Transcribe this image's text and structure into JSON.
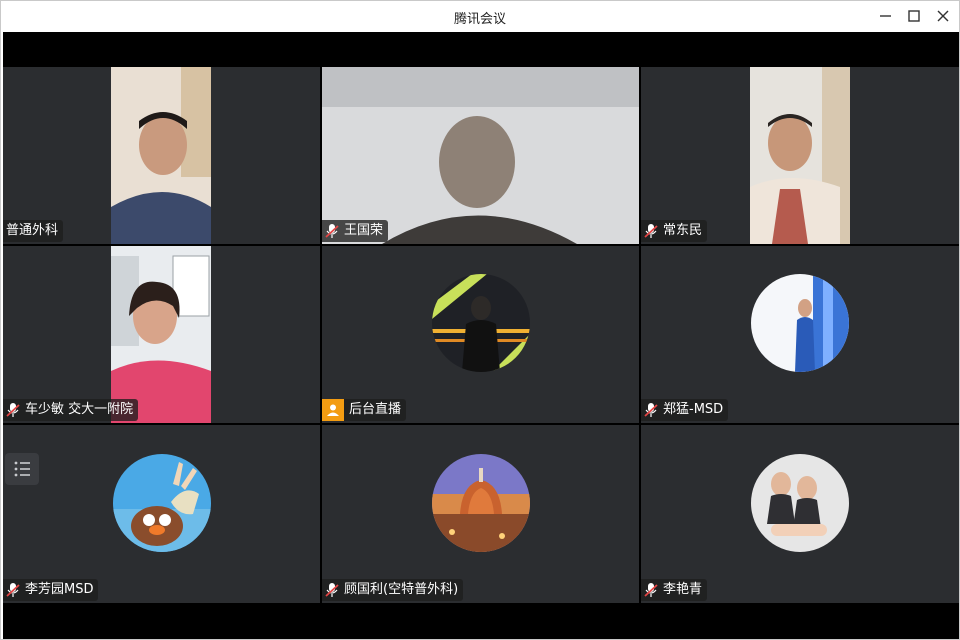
{
  "window": {
    "title": "腾讯会议"
  },
  "window_controls": [
    "minimize-icon",
    "maximize-icon",
    "close-icon"
  ],
  "colors": {
    "tile_bg": "#2b2d30",
    "label_bg": "#1e1e1e",
    "live_badge": "#f39c12",
    "mic_red": "#e54545"
  },
  "participants": [
    {
      "name": "普通外科",
      "mic": false,
      "kind": "video"
    },
    {
      "name": "王国荣",
      "mic": true,
      "kind": "video"
    },
    {
      "name": "常东民",
      "mic": true,
      "kind": "video"
    },
    {
      "name": "车少敏 交大一附院",
      "mic": true,
      "kind": "video"
    },
    {
      "name": "后台直播",
      "mic": false,
      "live": true,
      "kind": "avatar"
    },
    {
      "name": "郑猛-MSD",
      "mic": true,
      "kind": "avatar"
    },
    {
      "name": "李芳园MSD",
      "mic": true,
      "kind": "avatar"
    },
    {
      "name": "顾国利(空特普外科)",
      "mic": true,
      "kind": "avatar"
    },
    {
      "name": "李艳青",
      "mic": true,
      "kind": "avatar"
    }
  ],
  "side_toolbar": {
    "icon": "list-icon"
  }
}
